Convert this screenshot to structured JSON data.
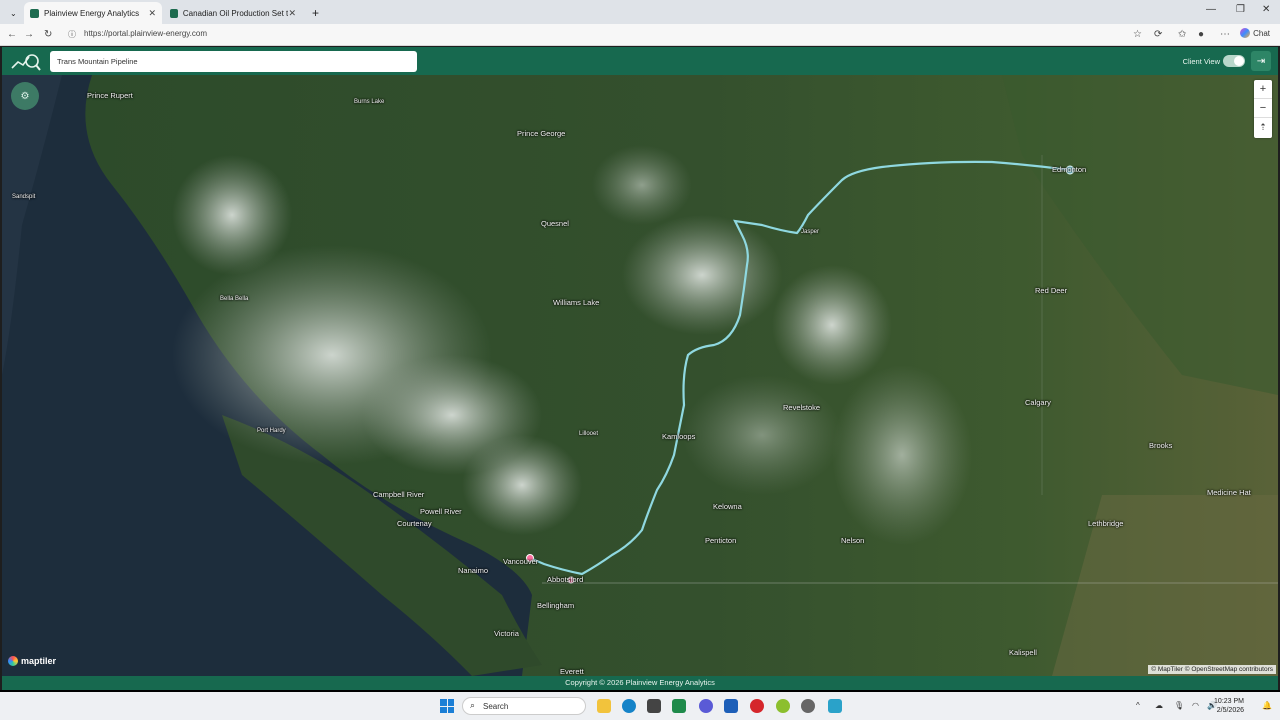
{
  "browser": {
    "tabs": [
      {
        "title": "Plainview Energy Analytics",
        "active": true
      },
      {
        "title": "Canadian Oil Production Set to Gr",
        "active": false
      }
    ],
    "url": "https://portal.plainview-energy.com",
    "chat_label": "Chat"
  },
  "app": {
    "search_value": "Trans Mountain Pipeline",
    "client_view_label": "Client View",
    "client_view_on": true,
    "footer": "Copyright © 2026 Plainview Energy Analytics",
    "brand_color": "#17694f"
  },
  "map": {
    "pipeline_color": "#8fd8e0",
    "labels": [
      {
        "name": "Prince Rupert"
      },
      {
        "name": "Burns Lake"
      },
      {
        "name": "Prince George"
      },
      {
        "name": "Sandspit"
      },
      {
        "name": "Quesnel"
      },
      {
        "name": "Bella Bella"
      },
      {
        "name": "Williams Lake"
      },
      {
        "name": "Port Hardy"
      },
      {
        "name": "Lillooet"
      },
      {
        "name": "Kamloops"
      },
      {
        "name": "Revelstoke"
      },
      {
        "name": "Campbell River"
      },
      {
        "name": "Powell River"
      },
      {
        "name": "Courtenay"
      },
      {
        "name": "Kelowna"
      },
      {
        "name": "Penticton"
      },
      {
        "name": "Nelson"
      },
      {
        "name": "Vancouver"
      },
      {
        "name": "Nanaimo"
      },
      {
        "name": "Abbotsford"
      },
      {
        "name": "Bellingham"
      },
      {
        "name": "Victoria"
      },
      {
        "name": "Everett"
      },
      {
        "name": "Edmonton"
      },
      {
        "name": "Jasper"
      },
      {
        "name": "Red Deer"
      },
      {
        "name": "Calgary"
      },
      {
        "name": "Brooks"
      },
      {
        "name": "Medicine Hat"
      },
      {
        "name": "Lethbridge"
      },
      {
        "name": "Kalispell"
      }
    ],
    "attribution": "© MapTiler © OpenStreetMap contributors",
    "logo_text": "maptiler",
    "zoom_in": "+",
    "zoom_out": "−",
    "compass": "⇡"
  },
  "taskbar": {
    "search_placeholder": "Search",
    "time": "10:23 PM",
    "date": "2/5/2026"
  }
}
